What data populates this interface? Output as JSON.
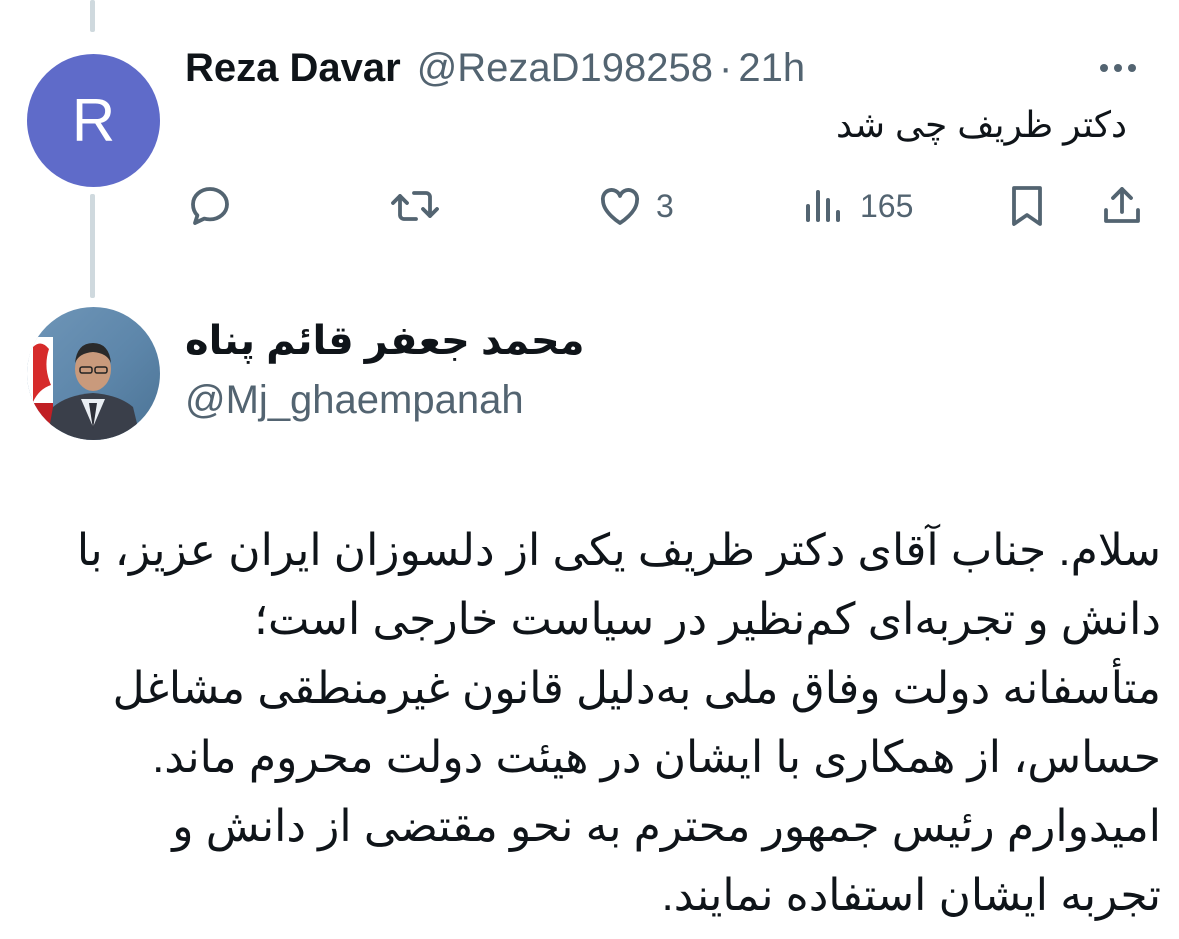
{
  "reply_tweet": {
    "avatar_letter": "R",
    "display_name": "Reza Davar",
    "handle": "@RezaD198258",
    "separator": "·",
    "time": "21h",
    "text": "دکتر ظریف چی شد",
    "actions": {
      "likes": "3",
      "views": "165"
    },
    "avatar_color": "#5f6bc9"
  },
  "quoted_tweet": {
    "display_name": "محمد جعفر قائم پناه",
    "handle": "@Mj_ghaempanah",
    "lines": [
      "سلام. جناب آقای دکتر ظریف یکی از دلسوزان ایران عزیز، با",
      "دانش و تجربه‌ای کم‌نظیر در سیاست خارجی است؛",
      "متأسفانه دولت وفاق ملی به‌دلیل قانون غیرمنطقی مشاغل",
      "حساس، از همکاری با ایشان در هیئت دولت محروم ماند.",
      "امیدوارم رئیس جمهور محترم به نحو مقتضی از دانش و",
      "تجربه ایشان استفاده نمایند."
    ]
  },
  "icons": [
    "more-icon",
    "reply-icon",
    "retweet-icon",
    "like-icon",
    "views-icon",
    "bookmark-icon",
    "share-icon"
  ],
  "colors": {
    "text_primary": "#0f1419",
    "text_secondary": "#536471",
    "thread_line": "#cfd9de"
  }
}
